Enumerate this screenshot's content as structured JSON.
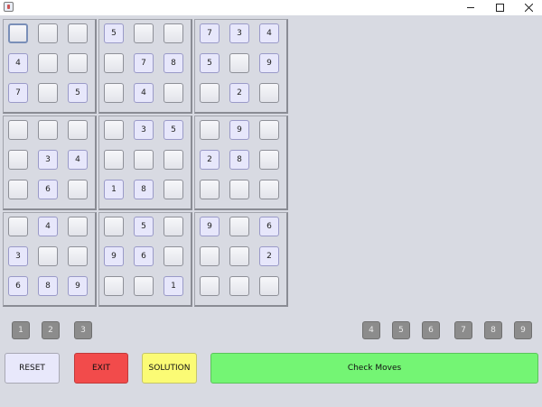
{
  "window": {
    "title": ""
  },
  "grid": [
    [
      "",
      "",
      "",
      "5",
      "",
      "",
      "7",
      "3",
      "4"
    ],
    [
      "4",
      "",
      "",
      "",
      "7",
      "8",
      "5",
      "",
      "9"
    ],
    [
      "7",
      "",
      "5",
      "",
      "4",
      "",
      "",
      "2",
      ""
    ],
    [
      "",
      "",
      "",
      "",
      "3",
      "5",
      "",
      "9",
      ""
    ],
    [
      "",
      "3",
      "4",
      "",
      "",
      "",
      "2",
      "8",
      ""
    ],
    [
      "",
      "6",
      "",
      "1",
      "8",
      "",
      "",
      "",
      ""
    ],
    [
      "",
      "4",
      "",
      "",
      "5",
      "",
      "9",
      "",
      "6"
    ],
    [
      "3",
      "",
      "",
      "9",
      "6",
      "",
      "",
      "",
      "2"
    ],
    [
      "6",
      "8",
      "9",
      "",
      "",
      "1",
      "",
      "",
      ""
    ]
  ],
  "selected_cell": {
    "row": 0,
    "col": 0
  },
  "numpad": [
    "1",
    "2",
    "3",
    "4",
    "5",
    "6",
    "7",
    "8",
    "9"
  ],
  "buttons": {
    "reset": "RESET",
    "exit": "EXIT",
    "solution": "SOLUTION",
    "check": "Check Moves"
  },
  "colors": {
    "given_cell": "#e7e7fb",
    "reset": "#e8e8fb",
    "exit": "#f24b4b",
    "solution": "#fbfb75",
    "check": "#74f574",
    "numpad": "#8c8c8c"
  }
}
